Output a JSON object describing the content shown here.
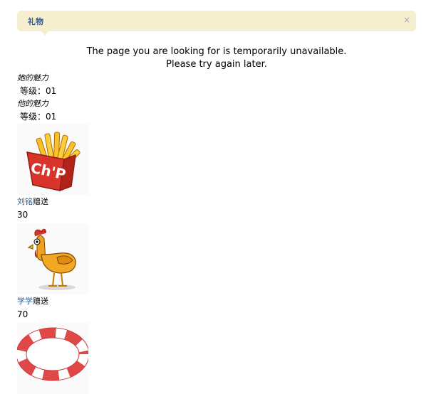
{
  "tab": {
    "title": "礼物",
    "close_label": "×"
  },
  "error": {
    "line1": "The page you are looking for is temporarily unavailable.",
    "line2": "Please try again later."
  },
  "charm": [
    {
      "title": "她的魅力",
      "level": "等级：01"
    },
    {
      "title": "他的魅力",
      "level": "等级：01"
    }
  ],
  "gifts": [
    {
      "image": "french-fries",
      "giver": "刘铭",
      "verb": "赠送",
      "count": "30"
    },
    {
      "image": "rubber-chicken",
      "giver": "学学",
      "verb": "赠送",
      "count": "70"
    },
    {
      "image": "life-ring"
    }
  ]
}
